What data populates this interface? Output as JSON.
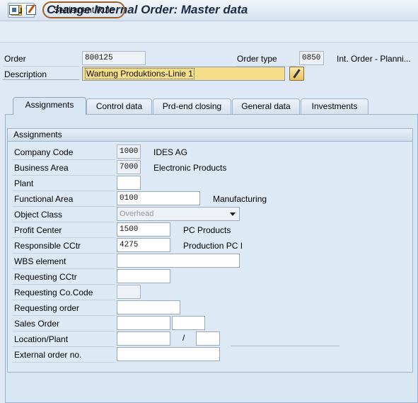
{
  "window": {
    "title": "Change Internal Order: Master data",
    "menu_icon": "sap-menu-icon"
  },
  "toolbar": {
    "icons": [
      "document-overview-icon",
      "edit-document-icon"
    ],
    "settlement_rule_label": "Settlement Rule"
  },
  "header": {
    "order_label": "Order",
    "order_value": "800125",
    "order_type_label": "Order type",
    "order_type_value": "0850",
    "order_type_text": "Int. Order - Planni...",
    "description_label": "Description",
    "description_value": "Wartung Produktions-Linie 1"
  },
  "tabs": [
    {
      "label": "Assignments",
      "active": true
    },
    {
      "label": "Control data",
      "active": false
    },
    {
      "label": "Prd-end closing",
      "active": false
    },
    {
      "label": "General data",
      "active": false
    },
    {
      "label": "Investments",
      "active": false
    }
  ],
  "assignments": {
    "group_title": "Assignments",
    "company_code": {
      "label": "Company Code",
      "value": "1000",
      "text": "IDES AG"
    },
    "business_area": {
      "label": "Business Area",
      "value": "7000",
      "text": "Electronic Products"
    },
    "plant": {
      "label": "Plant",
      "value": ""
    },
    "functional_area": {
      "label": "Functional Area",
      "value": "0100",
      "text": "Manufacturing"
    },
    "object_class": {
      "label": "Object Class",
      "value": "Overhead"
    },
    "profit_center": {
      "label": "Profit Center",
      "value": "1500",
      "text": "PC Products"
    },
    "responsible_cctr": {
      "label": "Responsible CCtr",
      "value": "4275",
      "text": "Production PC I"
    },
    "wbs_element": {
      "label": "WBS element",
      "value": ""
    },
    "requesting_cctr": {
      "label": "Requesting CCtr",
      "value": ""
    },
    "requesting_cocode": {
      "label": "Requesting Co.Code",
      "value": ""
    },
    "requesting_order": {
      "label": "Requesting order",
      "value": ""
    },
    "sales_order": {
      "label": "Sales Order",
      "value": "",
      "item_value": ""
    },
    "location_plant": {
      "label": "Location/Plant",
      "value": "",
      "separator": "/",
      "plant_value": ""
    },
    "external_order": {
      "label": "External order no.",
      "value": ""
    }
  },
  "colors": {
    "background": "#dfe9f5",
    "highlight_field": "#f5dd8a",
    "title_text": "#1a2b45",
    "annotation_circle": "#a0602a"
  }
}
